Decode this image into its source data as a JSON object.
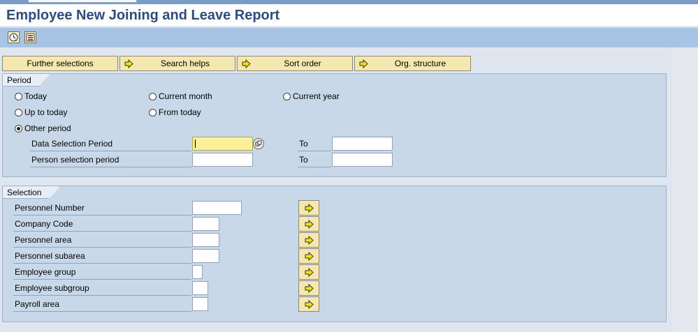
{
  "window": {
    "title": "Employee New Joining and Leave Report"
  },
  "toolbar": {
    "icons": [
      "execute-clock-icon",
      "selection-screen-icon"
    ]
  },
  "selection_buttons": [
    {
      "label": "Further selections",
      "has_arrow": false
    },
    {
      "label": "Search helps",
      "has_arrow": true
    },
    {
      "label": "Sort order",
      "has_arrow": true
    },
    {
      "label": "Org. structure",
      "has_arrow": true
    }
  ],
  "period": {
    "title": "Period",
    "options": {
      "today": {
        "label": "Today",
        "selected": false
      },
      "current_month": {
        "label": "Current month",
        "selected": false
      },
      "current_year": {
        "label": "Current year",
        "selected": false
      },
      "up_to_today": {
        "label": "Up to today",
        "selected": false
      },
      "from_today": {
        "label": "From today",
        "selected": false
      },
      "other_period": {
        "label": "Other period",
        "selected": true
      }
    },
    "data_selection": {
      "label": "Data Selection Period",
      "from": "",
      "to_label": "To",
      "to": ""
    },
    "person_selection": {
      "label": "Person selection period",
      "from": "",
      "to_label": "To",
      "to": ""
    }
  },
  "selection": {
    "title": "Selection",
    "fields": [
      {
        "label": "Personnel Number",
        "value": ""
      },
      {
        "label": "Company Code",
        "value": ""
      },
      {
        "label": "Personnel area",
        "value": ""
      },
      {
        "label": "Personnel subarea",
        "value": ""
      },
      {
        "label": "Employee group",
        "value": ""
      },
      {
        "label": "Employee subgroup",
        "value": ""
      },
      {
        "label": "Payroll area",
        "value": ""
      }
    ]
  },
  "colors": {
    "title": "#2d4d7c",
    "toolbar": "#a8c4e4",
    "group_bg": "#c8d8e8",
    "button_bg": "#f4e7b0",
    "active_input": "#fcef9a"
  }
}
